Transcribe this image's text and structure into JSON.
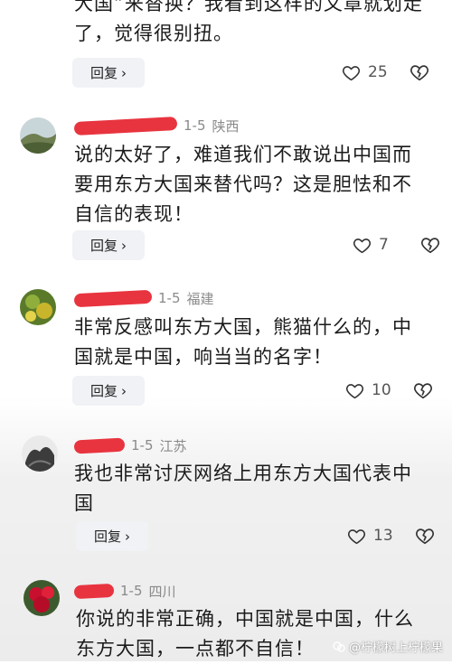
{
  "comments": [
    {
      "text": "大国”来替换？我看到这样的文章就划走\n了，觉得很别扭。",
      "reply_label": "回复",
      "likes": "25"
    },
    {
      "date": "1-5",
      "region": "陕西",
      "text": "说的太好了，难道我们不敢说出中国而\n要用东方大国来替代吗？这是胆怯和不\n自信的表现！",
      "reply_label": "回复",
      "likes": "7"
    },
    {
      "date": "1-5",
      "region": "福建",
      "text": "非常反感叫东方大国，熊猫什么的，中\n国就是中国，响当当的名字！",
      "reply_label": "回复",
      "likes": "10"
    },
    {
      "date": "1-5",
      "region": "江苏",
      "text": "我也非常讨厌网络上用东方大国代表中\n国",
      "reply_label": "回复",
      "likes": "13"
    },
    {
      "date": "1-5",
      "region": "四川",
      "text": "你说的非常正确，中国就是中国，什么\n东方大国，一点都不自信！"
    }
  ],
  "watermark": "@柠檬树上柠檬果",
  "colors": {
    "redaction": "#e8343f",
    "reply_bg": "#f0f2f5",
    "meta_text": "#8a8a8a"
  },
  "icons": [
    "heart-icon",
    "broken-heart-icon",
    "chevron-right-icon",
    "watermark-logo-icon"
  ]
}
